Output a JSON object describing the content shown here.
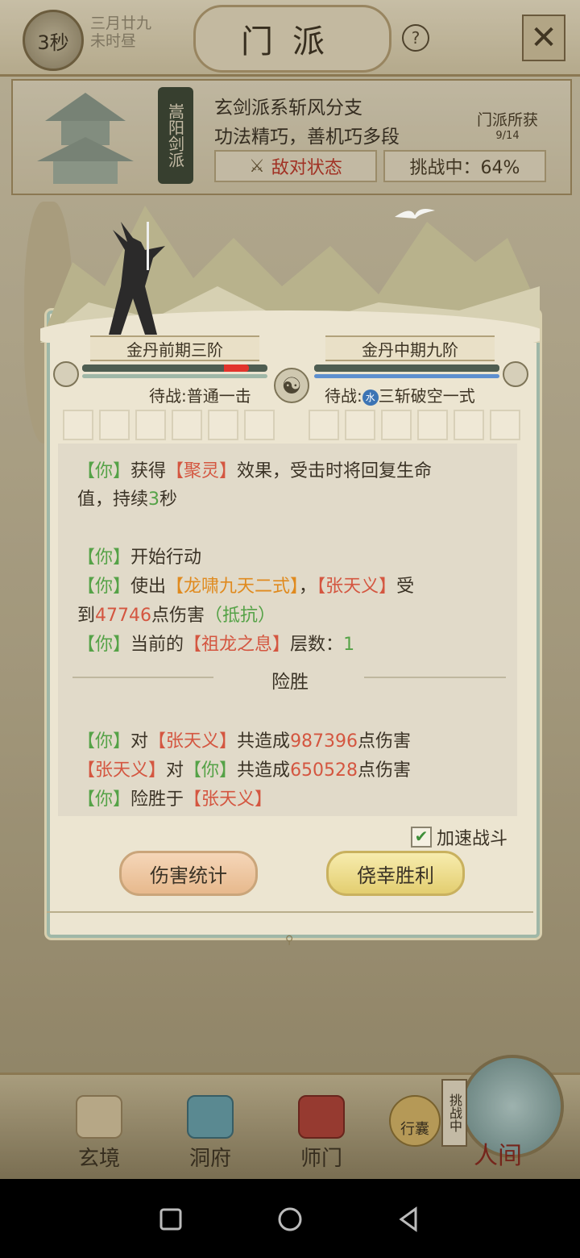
{
  "topbar": {
    "timer": "3秒",
    "date_line1": "三月廿九",
    "date_line2": "未时昼",
    "title": "门派",
    "help": "?",
    "close": "✕"
  },
  "sect": {
    "badge": "嵩阳剑派",
    "desc_line1": "玄剑派系斩风分支",
    "desc_line2": "功法精巧，善机巧多段",
    "hostile_state": "敌对状态",
    "challenge": "挑战中：64%",
    "gain_label": "门派所获",
    "gain_count": "9/14"
  },
  "battle": {
    "left": {
      "realm": "金丹前期三阶",
      "hp": 0.9,
      "standby_label": "待战",
      "standby_skill": ":普通一击"
    },
    "right": {
      "realm": "金丹中期九阶",
      "hp": 1.0,
      "standby_label": "待战",
      "standby_icon": "水",
      "standby_skill": "三斩破空一式"
    },
    "taiji": "☯",
    "log": {
      "l1": {
        "a": "【你】",
        "b": "获得",
        "c": "【聚灵】",
        "d": "效果，受击时将回复生命"
      },
      "l2": {
        "a": "值，持续",
        "b": "3",
        "c": "秒"
      },
      "l3": {
        "a": "【你】",
        "b": "开始行动"
      },
      "l4": {
        "a": "【你】",
        "b": "使出",
        "c": "【龙啸九天二式】",
        "d": "，",
        "e": "【张天义】",
        "f": "受"
      },
      "l5": {
        "a": "到",
        "b": "47746",
        "c": "点伤害",
        "d": "（抵抗）"
      },
      "l6": {
        "a": "【你】",
        "b": "当前的",
        "c": "【祖龙之息】",
        "d": "层数：",
        "e": "1"
      },
      "result_title": "险胜",
      "l7": {
        "a": "【你】",
        "b": "对",
        "c": "【张天义】",
        "d": "共造成",
        "e": "987396",
        "f": "点伤害"
      },
      "l8": {
        "a": "【张天义】",
        "b": "对",
        "c": "【你】",
        "d": "共造成",
        "e": "650528",
        "f": "点伤害"
      },
      "l9": {
        "a": "【你】",
        "b": "险胜于",
        "c": "【张天义】"
      }
    },
    "speed_label": "加速战斗",
    "speed_checked": true,
    "btn_stats": "伤害统计",
    "btn_win": "侥幸胜利"
  },
  "bottom_tabs": {
    "t1": "玄境",
    "t2": "洞府",
    "t3": "师门",
    "t4": "行囊",
    "challenge_tag": "挑战中",
    "t5": "人间"
  },
  "colors": {
    "hp_left": "#e2342c",
    "hp_right": "#5d8fcf",
    "green": "#55a247",
    "red": "#d45640",
    "orange": "#e08a1e"
  }
}
